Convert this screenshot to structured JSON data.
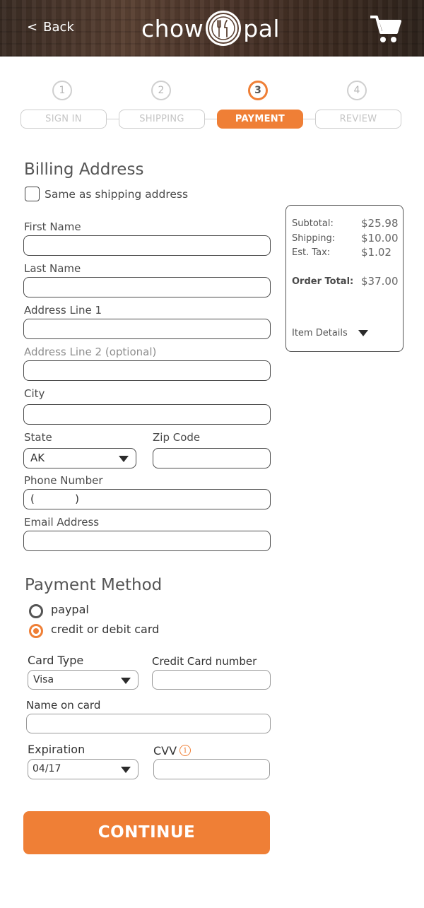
{
  "header": {
    "back_label": "Back",
    "logo_left": "chow",
    "logo_right": "pal"
  },
  "stepper": {
    "steps": [
      {
        "number": "1",
        "label": "SIGN IN"
      },
      {
        "number": "2",
        "label": "SHIPPING"
      },
      {
        "number": "3",
        "label": "PAYMENT"
      },
      {
        "number": "4",
        "label": "REVIEW"
      }
    ],
    "active_index": 2
  },
  "billing": {
    "title": "Billing Address",
    "same_as_shipping_label": "Same as shipping address",
    "same_as_shipping_checked": false,
    "first_name_label": "First Name",
    "last_name_label": "Last Name",
    "address1_label": "Address Line 1",
    "address2_label": "Address Line 2 (optional)",
    "city_label": "City",
    "state_label": "State",
    "state_value": "AK",
    "zip_label": "Zip Code",
    "phone_label": "Phone Number",
    "phone_value": "(            )",
    "email_label": "Email Address"
  },
  "summary": {
    "subtotal_label": "Subtotal:",
    "subtotal_value": "$25.98",
    "shipping_label": "Shipping:",
    "shipping_value": "$10.00",
    "tax_label": "Est. Tax:",
    "tax_value": "$1.02",
    "total_label": "Order Total:",
    "total_value": "$37.00",
    "item_details_label": "Item Details"
  },
  "payment": {
    "title": "Payment Method",
    "option_paypal": "paypal",
    "option_card": "credit or debit card",
    "selected": "credit or debit card",
    "card_type_label": "Card Type",
    "card_type_value": "Visa",
    "card_number_label": "Credit Card number",
    "name_on_card_label": "Name on card",
    "expiration_label": "Expiration",
    "expiration_value": "04/17",
    "cvv_label": "CVV",
    "info_glyph": "i"
  },
  "continue_label": "CONTINUE",
  "colors": {
    "accent": "#ef7f36",
    "header_wood": "#4a3429"
  }
}
